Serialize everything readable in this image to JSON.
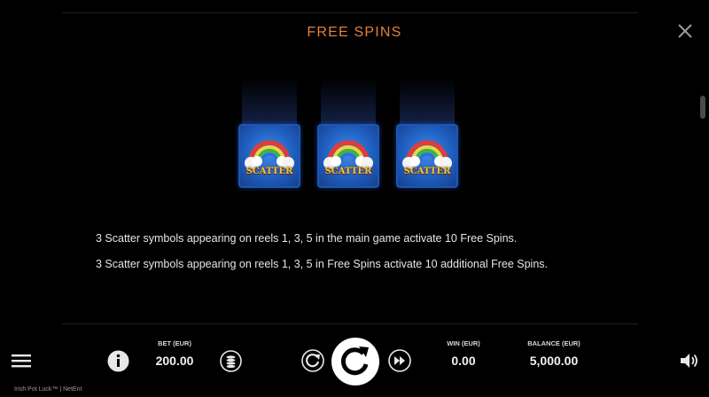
{
  "header": {
    "title": "FREE SPINS"
  },
  "symbols": [
    {
      "label": "SCATTER"
    },
    {
      "label": "SCATTER"
    },
    {
      "label": "SCATTER"
    }
  ],
  "rules": [
    "3 Scatter symbols appearing on reels 1, 3, 5 in the main game activate 10 Free Spins.",
    "3 Scatter symbols appearing on reels 1, 3, 5 in Free Spins activate 10 additional Free Spins."
  ],
  "bottom_bar": {
    "bet_label": "BET (EUR)",
    "bet_value": "200.00",
    "win_label": "WIN (EUR)",
    "win_value": "0.00",
    "balance_label": "BALANCE (EUR)",
    "balance_value": "5,000.00"
  },
  "footer": {
    "text": "Irish Pot Luck™  |  NetEnt"
  },
  "colors": {
    "title": "#e0823a",
    "background": "#000000",
    "symbol_blue": "#1f5fc0"
  },
  "icons": {
    "close": "close-icon",
    "menu": "menu-icon",
    "info": "info-icon",
    "coins": "coin-stack-icon",
    "autoplay": "autoplay-icon",
    "spin": "spin-icon",
    "fast_forward": "fast-forward-icon",
    "sound": "speaker-icon"
  }
}
